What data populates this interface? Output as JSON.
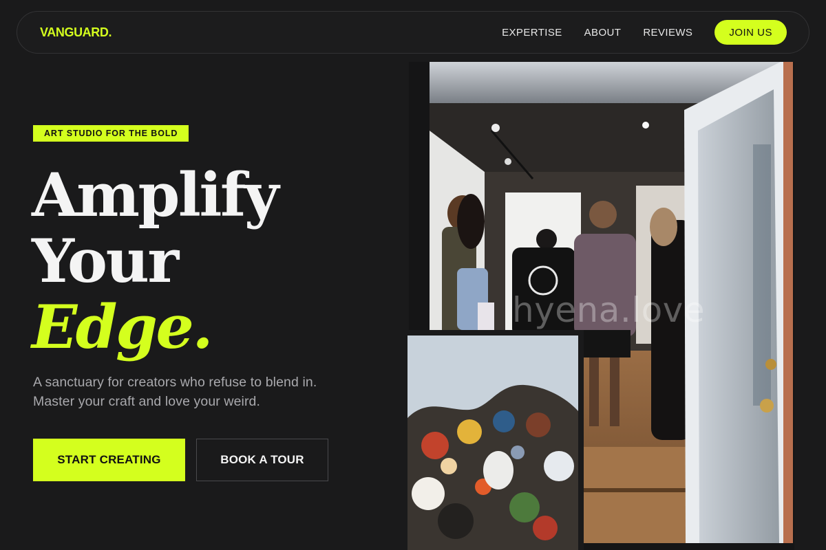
{
  "nav": {
    "logo": "VANGUARD.",
    "links": [
      "EXPERTISE",
      "ABOUT",
      "REVIEWS"
    ],
    "cta": "JOIN US"
  },
  "hero": {
    "badge": "ART STUDIO FOR THE BOLD",
    "headline_line1": "Amplify",
    "headline_line2": "Your",
    "headline_accent": "Edge.",
    "subtext": "A sanctuary for creators who refuse to blend in. Master your craft and love your weird.",
    "primary_cta": "START CREATING",
    "secondary_cta": "BOOK A TOUR"
  },
  "images": {
    "watermark": "hyena.love"
  },
  "colors": {
    "accent": "#d4ff1e",
    "background": "#1a1a1b",
    "text_muted": "#a9a9ad"
  }
}
